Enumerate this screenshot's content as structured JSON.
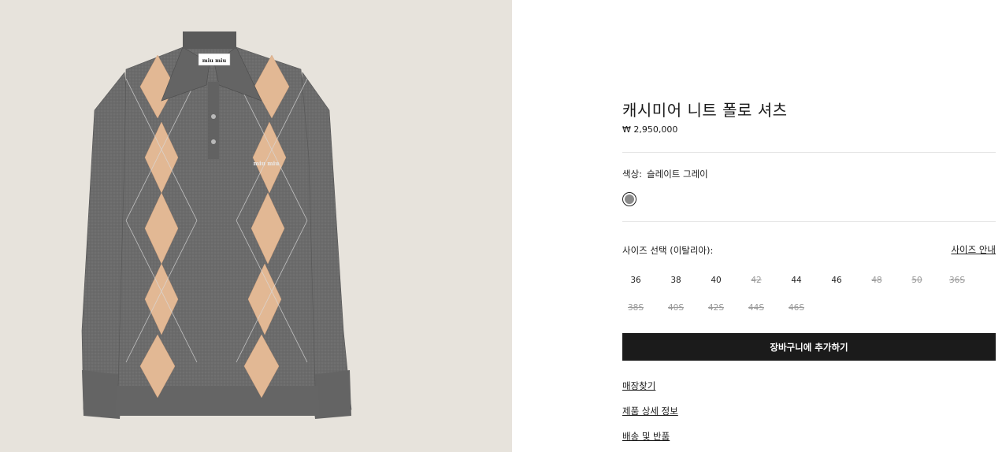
{
  "product": {
    "image_alt": "cashmere argyle polo sweater",
    "title": "캐시미어 니트 폴로 셔츠",
    "price": "₩ 2,950,000",
    "brand_tag": "miu miu",
    "chest_logo": "miu miu"
  },
  "color": {
    "label": "색상:",
    "value": "슬레이트 그레이",
    "swatch_color": "#8a8a8a"
  },
  "size": {
    "label": "사이즈 선택 (이탈리아):",
    "guide_link": "사이즈 안내",
    "options": [
      {
        "label": "36",
        "available": true
      },
      {
        "label": "38",
        "available": true
      },
      {
        "label": "40",
        "available": true
      },
      {
        "label": "42",
        "available": false
      },
      {
        "label": "44",
        "available": true
      },
      {
        "label": "46",
        "available": true
      },
      {
        "label": "48",
        "available": false
      },
      {
        "label": "50",
        "available": false
      },
      {
        "label": "36S",
        "available": false
      },
      {
        "label": "38S",
        "available": false
      },
      {
        "label": "40S",
        "available": false
      },
      {
        "label": "42S",
        "available": false
      },
      {
        "label": "44S",
        "available": false
      },
      {
        "label": "46S",
        "available": false
      }
    ]
  },
  "actions": {
    "add_to_cart": "장바구니에 추가하기",
    "find_store": "매장찾기",
    "product_details": "제품 상세 정보",
    "shipping_returns": "배송 및 반품"
  },
  "colors": {
    "image_background": "#e7e3dc",
    "sweater": "#6a6a6a",
    "argyle": "#e0b592",
    "button": "#1b1b1b"
  }
}
